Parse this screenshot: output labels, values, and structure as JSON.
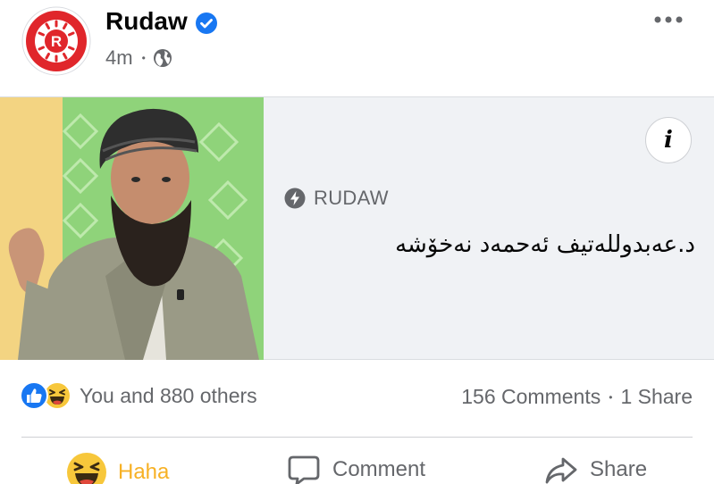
{
  "post": {
    "page_name": "Rudaw",
    "avatar_letter": "R",
    "time": "4m",
    "meta_separator": "•"
  },
  "link_card": {
    "source": "RUDAW",
    "headline": "د.عەبدوللەتیف ئەحمەد نەخۆشە",
    "info_label": "i"
  },
  "stats": {
    "reaction_text": "You and 880 others",
    "comments": "156 Comments",
    "separator": "•",
    "shares": "1 Share"
  },
  "actions": {
    "react_label": "Haha",
    "comment_label": "Comment",
    "share_label": "Share"
  },
  "colors": {
    "brand_red": "#e0262b",
    "verified_blue": "#1877f2",
    "haha_yellow": "#f7b125",
    "secondary_text": "#65676b"
  },
  "icons": [
    "rudaw-logo-icon",
    "verified-badge-icon",
    "globe-icon",
    "more-options-icon",
    "info-icon",
    "bolt-icon",
    "like-reaction-icon",
    "haha-reaction-icon",
    "comment-icon",
    "share-icon"
  ]
}
